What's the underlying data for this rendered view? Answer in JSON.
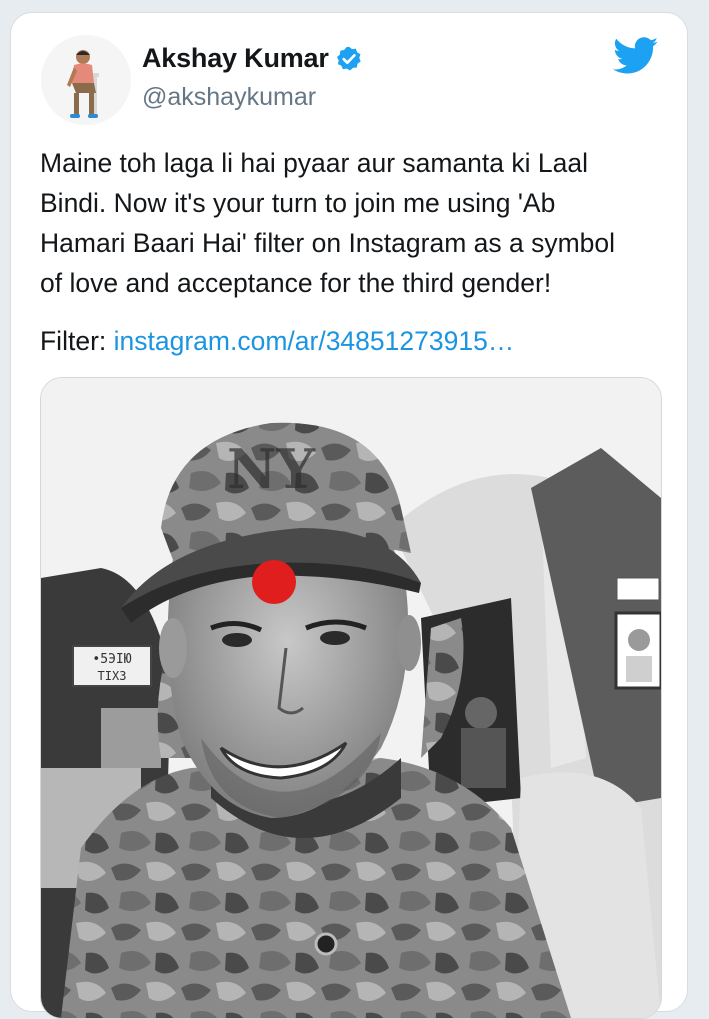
{
  "tweet": {
    "author": {
      "display_name": "Akshay Kumar",
      "handle": "@akshaykumar",
      "verified": true,
      "avatar_icon": "profile-photo"
    },
    "body": "Maine toh laga li hai pyaar aur samanta ki Laal\nBindi. Now it's your turn to join me using 'Ab\nHamari Baari Hai' filter on Instagram as a symbol\nof love and acceptance for the third gender!",
    "filter_prefix": "Filter: ",
    "filter_link": "instagram.com/ar/34851273915…",
    "media": {
      "description_icon": "black-and-white-selfie-photo",
      "sign_text_top": "•5ЭIЮ",
      "sign_text_bottom": "TIX3"
    }
  },
  "colors": {
    "twitter_blue": "#1da1f2",
    "link_blue": "#1b95e0",
    "bindi_red": "#e01e1e",
    "verified_blue": "#1da1f2",
    "handle_grey": "#657786"
  },
  "icons": {
    "brand": "twitter-bird-icon",
    "verified": "verified-badge-icon"
  }
}
